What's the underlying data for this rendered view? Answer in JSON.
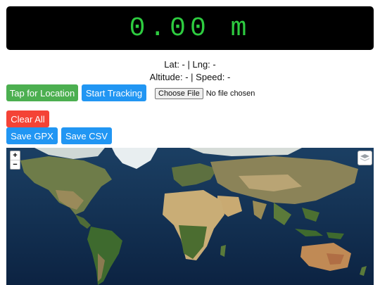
{
  "display": {
    "value": "0.00 m"
  },
  "coords": {
    "line1": "Lat: - | Lng: -",
    "line2": "Altitude: - | Speed: -"
  },
  "buttons": {
    "tap_location": "Tap for Location",
    "start_tracking": "Start Tracking",
    "clear_all": "Clear All",
    "save_gpx": "Save GPX",
    "save_csv": "Save CSV"
  },
  "file_input": {
    "button_label": "Choose File",
    "status": "No file chosen"
  },
  "map": {
    "zoom_in": "+",
    "zoom_out": "−",
    "layers_icon": "layers-icon"
  },
  "colors": {
    "display_text": "#2ecc40",
    "green": "#4caf50",
    "blue": "#2196f3",
    "red": "#f44336"
  }
}
